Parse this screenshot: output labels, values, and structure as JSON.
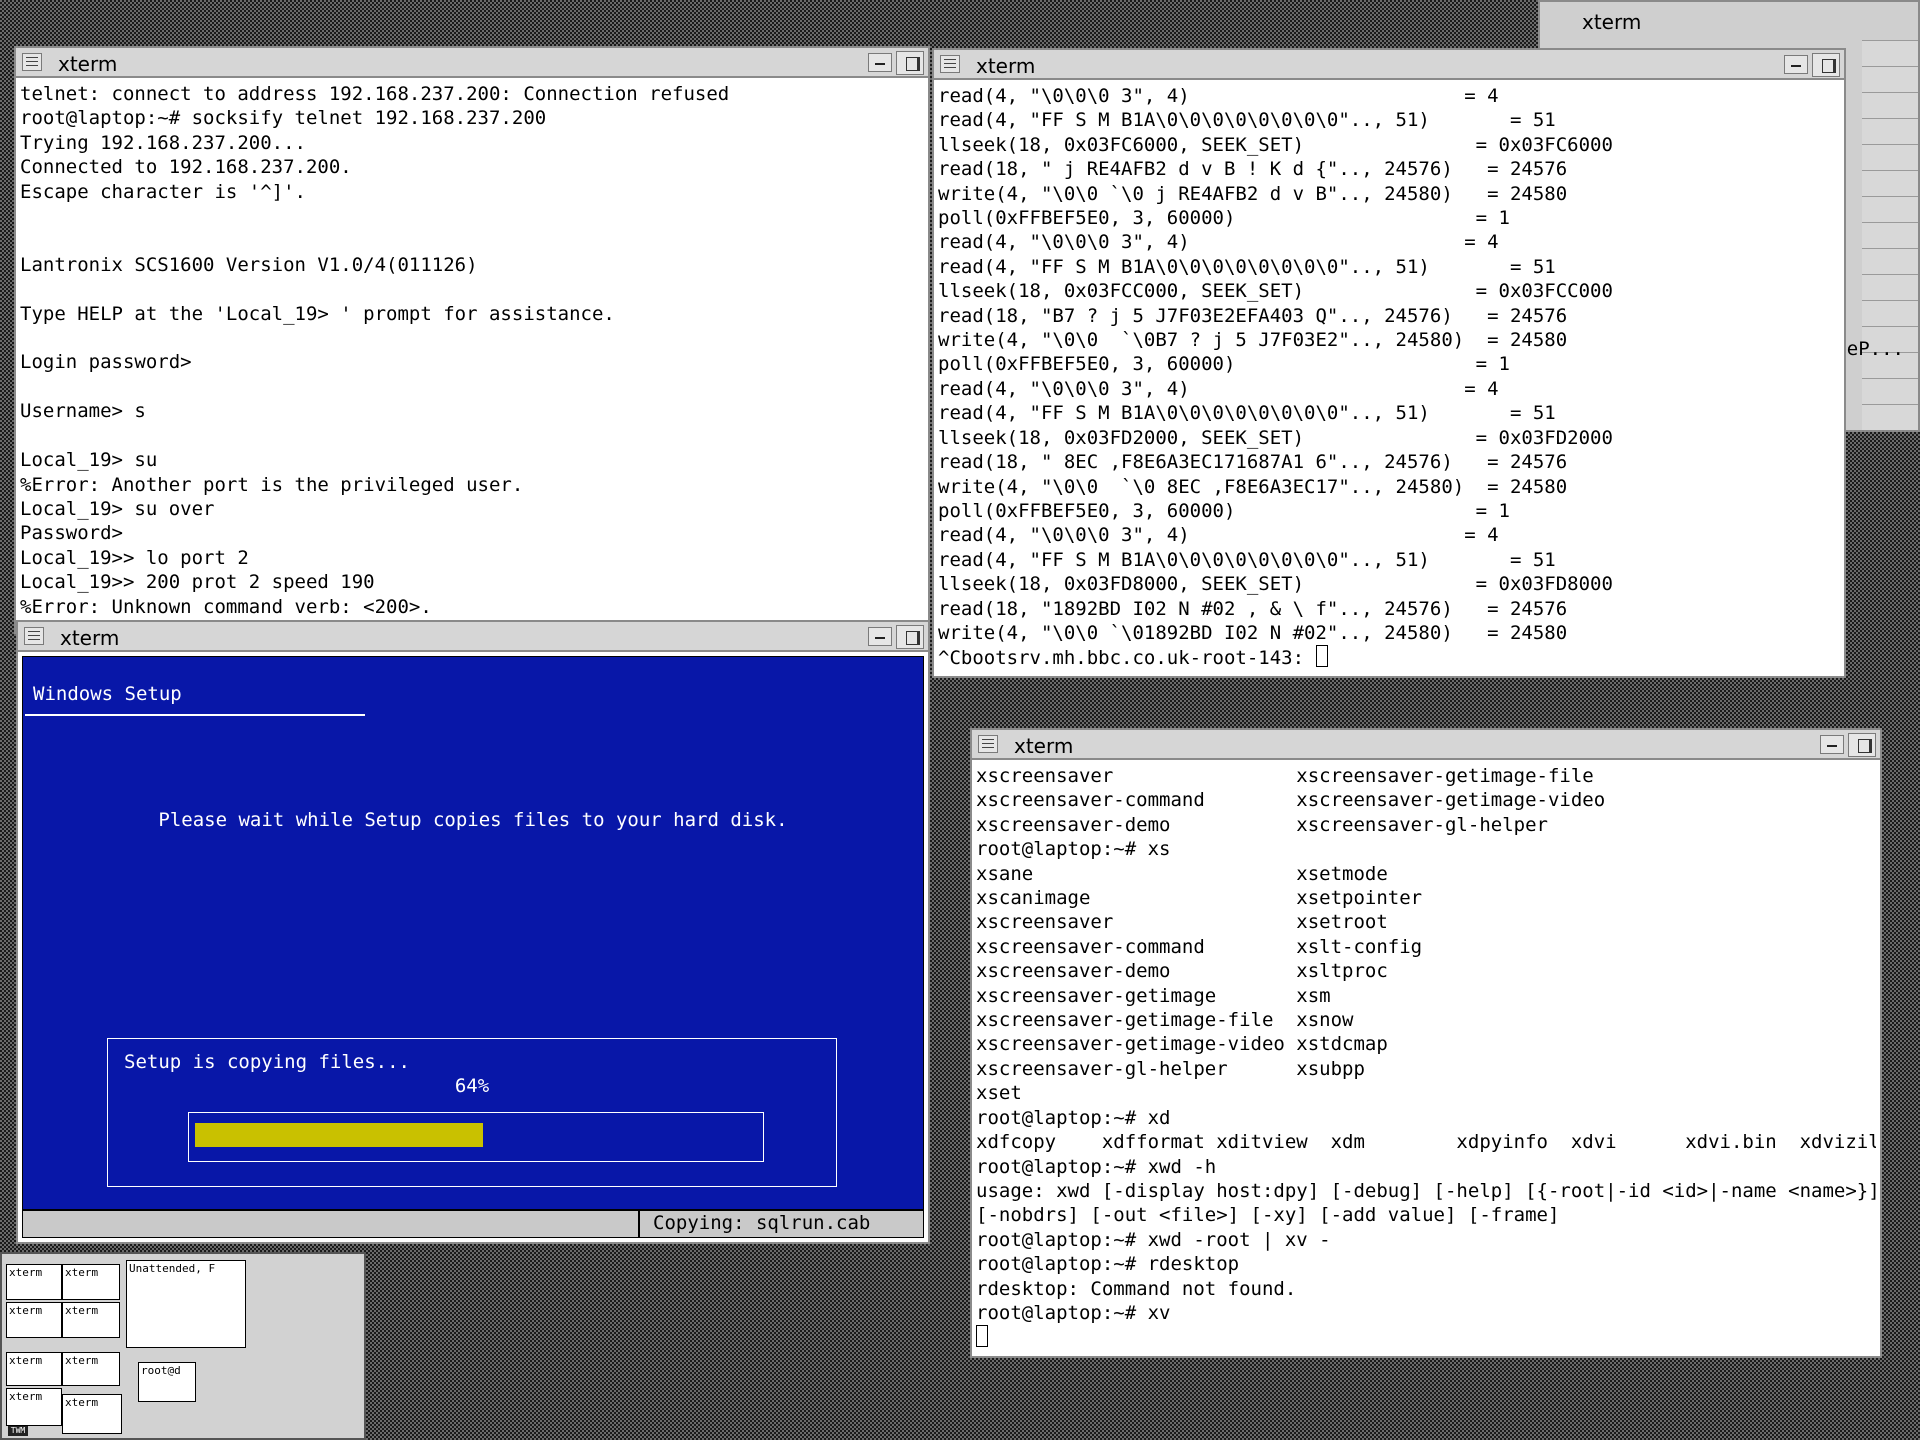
{
  "bg_window": {
    "title": "xterm",
    "partial_text": "eP..."
  },
  "terminal_telnet": {
    "title": "xterm",
    "lines": [
      "telnet: connect to address 192.168.237.200: Connection refused",
      "root@laptop:~# socksify telnet 192.168.237.200",
      "Trying 192.168.237.200...",
      "Connected to 192.168.237.200.",
      "Escape character is '^]'.",
      "",
      "",
      "Lantronix SCS1600 Version V1.0/4(011126)",
      "",
      "Type HELP at the 'Local_19> ' prompt for assistance.",
      "",
      "Login password>",
      "",
      "Username> s",
      "",
      "Local_19> su",
      "%Error: Another port is the privileged user.",
      "Local_19> su over",
      "Password>",
      "Local_19>> lo port 2",
      "Local_19>> 200 prot 2 speed 190",
      "%Error: Unknown command verb: <200>."
    ]
  },
  "terminal_strace": {
    "title": "xterm",
    "lines": [
      "read(4, \"\\0\\0\\0 3\", 4)                        = 4",
      "read(4, \"FF S M B1A\\0\\0\\0\\0\\0\\0\\0\\0\".., 51)       = 51",
      "llseek(18, 0x03FC6000, SEEK_SET)               = 0x03FC6000",
      "read(18, \" j RE4AFB2 d v B ! K d {\".., 24576)   = 24576",
      "write(4, \"\\0\\0 `\\0 j RE4AFB2 d v B\".., 24580)   = 24580",
      "poll(0xFFBEF5E0, 3, 60000)                     = 1",
      "read(4, \"\\0\\0\\0 3\", 4)                        = 4",
      "read(4, \"FF S M B1A\\0\\0\\0\\0\\0\\0\\0\\0\".., 51)       = 51",
      "llseek(18, 0x03FCC000, SEEK_SET)               = 0x03FCC000",
      "read(18, \"B7 ? j 5 J7F03E2EFA403 Q\".., 24576)   = 24576",
      "write(4, \"\\0\\0  `\\0B7 ? j 5 J7F03E2\".., 24580)  = 24580",
      "poll(0xFFBEF5E0, 3, 60000)                     = 1",
      "read(4, \"\\0\\0\\0 3\", 4)                        = 4",
      "read(4, \"FF S M B1A\\0\\0\\0\\0\\0\\0\\0\\0\".., 51)       = 51",
      "llseek(18, 0x03FD2000, SEEK_SET)               = 0x03FD2000",
      "read(18, \" 8EC ,F8E6A3EC171687A1 6\".., 24576)   = 24576",
      "write(4, \"\\0\\0  `\\0 8EC ,F8E6A3EC17\".., 24580)  = 24580",
      "poll(0xFFBEF5E0, 3, 60000)                     = 1",
      "read(4, \"\\0\\0\\0 3\", 4)                        = 4",
      "read(4, \"FF S M B1A\\0\\0\\0\\0\\0\\0\\0\\0\".., 51)       = 51",
      "llseek(18, 0x03FD8000, SEEK_SET)               = 0x03FD8000",
      "read(18, \"1892BD I02 N #02 , & \\ f\".., 24576)   = 24576",
      "write(4, \"\\0\\0 `\\01892BD I02 N #02\".., 24580)   = 24580"
    ],
    "prompt": "^Cbootsrv.mh.bbc.co.uk-root-143: "
  },
  "terminal_shell": {
    "title": "xterm",
    "lines": [
      "xscreensaver                xscreensaver-getimage-file",
      "xscreensaver-command        xscreensaver-getimage-video",
      "xscreensaver-demo           xscreensaver-gl-helper",
      "root@laptop:~# xs",
      "xsane                       xsetmode",
      "xscanimage                  xsetpointer",
      "xscreensaver                xsetroot",
      "xscreensaver-command        xslt-config",
      "xscreensaver-demo           xsltproc",
      "xscreensaver-getimage       xsm",
      "xscreensaver-getimage-file  xsnow",
      "xscreensaver-getimage-video xstdcmap",
      "xscreensaver-gl-helper      xsubpp",
      "xset",
      "root@laptop:~# xd",
      "xdfcopy    xdfformat xditview  xdm        xdpyinfo  xdvi      xdvi.bin  xdvizilla",
      "root@laptop:~# xwd -h",
      "usage: xwd [-display host:dpy] [-debug] [-help] [{-root|-id <id>|-name <name>}]",
      "[-nobdrs] [-out <file>] [-xy] [-add value] [-frame]",
      "root@laptop:~# xwd -root | xv -",
      "root@laptop:~# rdesktop",
      "rdesktop: Command not found.",
      "root@laptop:~# xv"
    ]
  },
  "windows_setup": {
    "title": "xterm",
    "heading": "Windows Setup",
    "message": "Please wait while Setup copies files to your hard disk.",
    "copying_label": "Setup is copying files...",
    "percent_text": "64%",
    "progress": 0.64,
    "status": "Copying: sqlrun.cab",
    "colors": {
      "background": "#0817a8",
      "progress_fill": "#c9c100",
      "text": "#ffffff"
    }
  },
  "pager": {
    "cells": [
      "xterm",
      "xterm",
      "Unattended, F",
      "xterm",
      "xterm",
      "xterm",
      "xterm",
      "xterm",
      "xterm",
      "root@d"
    ],
    "mark": "TWM"
  }
}
